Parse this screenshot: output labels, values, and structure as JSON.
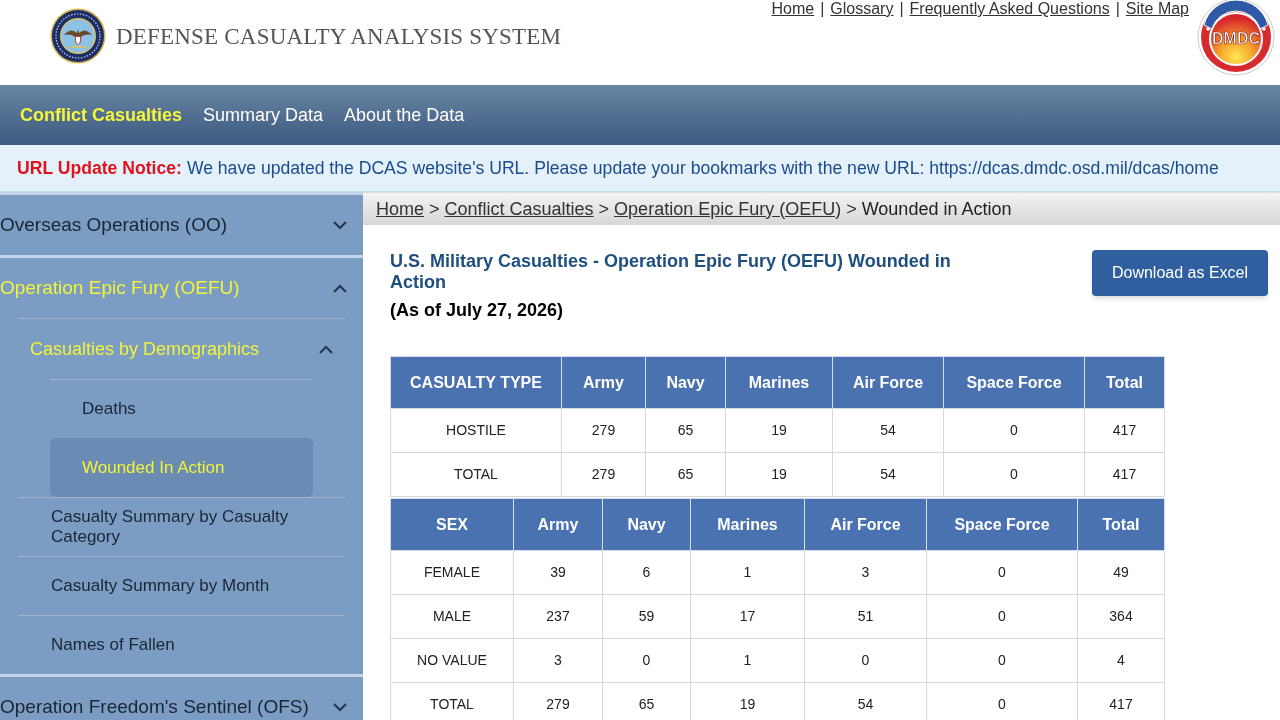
{
  "header": {
    "top_links": [
      "Home",
      "Glossary",
      "Frequently Asked Questions",
      "Site Map"
    ],
    "link_separator": "|",
    "title": "DEFENSE CASUALTY ANALYSIS SYSTEM",
    "logo_text": "DMDC"
  },
  "nav": [
    {
      "label": "Conflict Casualties",
      "selected": true
    },
    {
      "label": "Summary Data",
      "selected": false
    },
    {
      "label": "About the Data",
      "selected": false
    }
  ],
  "notice": {
    "label": "URL Update Notice:",
    "message": "We have updated the DCAS website's URL. Please update your bookmarks with the new URL: https://dcas.dmdc.osd.mil/dcas/home"
  },
  "sidebar": {
    "items": [
      {
        "label": "Overseas Operations (OO)",
        "selected": false,
        "expanded": false
      },
      {
        "label": "Operation Epic Fury (OEFU)",
        "selected": true,
        "expanded": true,
        "children": [
          {
            "label": "Casualties by Demographics",
            "selected": true,
            "expanded": true,
            "children": [
              {
                "label": "Deaths",
                "selected": false
              },
              {
                "label": "Wounded In Action",
                "selected": true
              }
            ]
          },
          {
            "label": "Casualty Summary by Casualty Category",
            "selected": false
          },
          {
            "label": "Casualty Summary by Month",
            "selected": false
          },
          {
            "label": "Names of Fallen",
            "selected": false
          }
        ]
      },
      {
        "label": "Operation Freedom's Sentinel (OFS)",
        "selected": false,
        "expanded": false
      }
    ]
  },
  "breadcrumb": {
    "separator": ">",
    "items": [
      {
        "label": "Home",
        "link": true
      },
      {
        "label": "Conflict Casualties",
        "link": true
      },
      {
        "label": "Operation Epic Fury (OEFU)",
        "link": true
      },
      {
        "label": "Wounded in Action",
        "link": false
      }
    ]
  },
  "page": {
    "title": "U.S. Military Casualties - Operation Epic Fury (OEFU) Wounded in Action",
    "as_of": "(As of July 27, 2026)",
    "download_button": "Download as Excel"
  },
  "tables": [
    {
      "columns": [
        "CASUALTY TYPE",
        "Army",
        "Navy",
        "Marines",
        "Air Force",
        "Space Force",
        "Total"
      ],
      "rows": [
        [
          "HOSTILE",
          "279",
          "65",
          "19",
          "54",
          "0",
          "417"
        ],
        [
          "TOTAL",
          "279",
          "65",
          "19",
          "54",
          "0",
          "417"
        ]
      ]
    },
    {
      "columns": [
        "SEX",
        "Army",
        "Navy",
        "Marines",
        "Air Force",
        "Space Force",
        "Total"
      ],
      "rows": [
        [
          "FEMALE",
          "39",
          "6",
          "1",
          "3",
          "0",
          "49"
        ],
        [
          "MALE",
          "237",
          "59",
          "17",
          "51",
          "0",
          "364"
        ],
        [
          "NO VALUE",
          "3",
          "0",
          "1",
          "0",
          "0",
          "4"
        ],
        [
          "TOTAL",
          "279",
          "65",
          "19",
          "54",
          "0",
          "417"
        ]
      ]
    }
  ]
}
